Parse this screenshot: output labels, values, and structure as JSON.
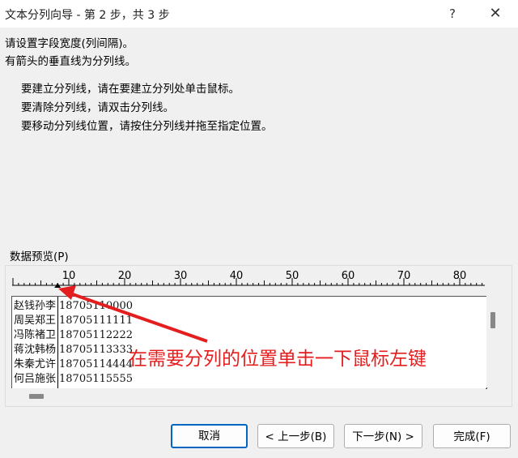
{
  "window": {
    "title": "文本分列向导 - 第 2 步，共 3 步",
    "help_glyph": "?",
    "close_glyph": "✕"
  },
  "instructions": {
    "line1": "请设置字段宽度(列间隔)。",
    "line2": "有箭头的垂直线为分列线。",
    "tip1": "要建立分列线，请在要建立分列处单击鼠标。",
    "tip2": "要清除分列线，请双击分列线。",
    "tip3": "要移动分列线位置，请按住分列线并拖至指定位置。"
  },
  "preview": {
    "label": "数据预览(P)",
    "ruler_ticks": [
      "10",
      "20",
      "30",
      "40",
      "50",
      "60",
      "70",
      "80"
    ],
    "rows": [
      {
        "name": "赵钱孙李",
        "phone": "18705110000"
      },
      {
        "name": "周吴郑王",
        "phone": "18705111111"
      },
      {
        "name": "冯陈褚卫",
        "phone": "18705112222"
      },
      {
        "name": "蒋沈韩杨",
        "phone": "18705113333"
      },
      {
        "name": "朱秦尤许",
        "phone": "18705114444"
      },
      {
        "name": "何吕施张",
        "phone": "18705115555"
      }
    ]
  },
  "annotation": {
    "text": "在需要分列的位置单击一下鼠标左键",
    "color": "#e41e1e"
  },
  "buttons": {
    "cancel": "取消",
    "back": "< 上一步(B)",
    "next": "下一步(N) >",
    "finish": "完成(F)"
  },
  "colors": {
    "accent": "#0067c0",
    "dialog_bg": "#f0f0f0"
  }
}
